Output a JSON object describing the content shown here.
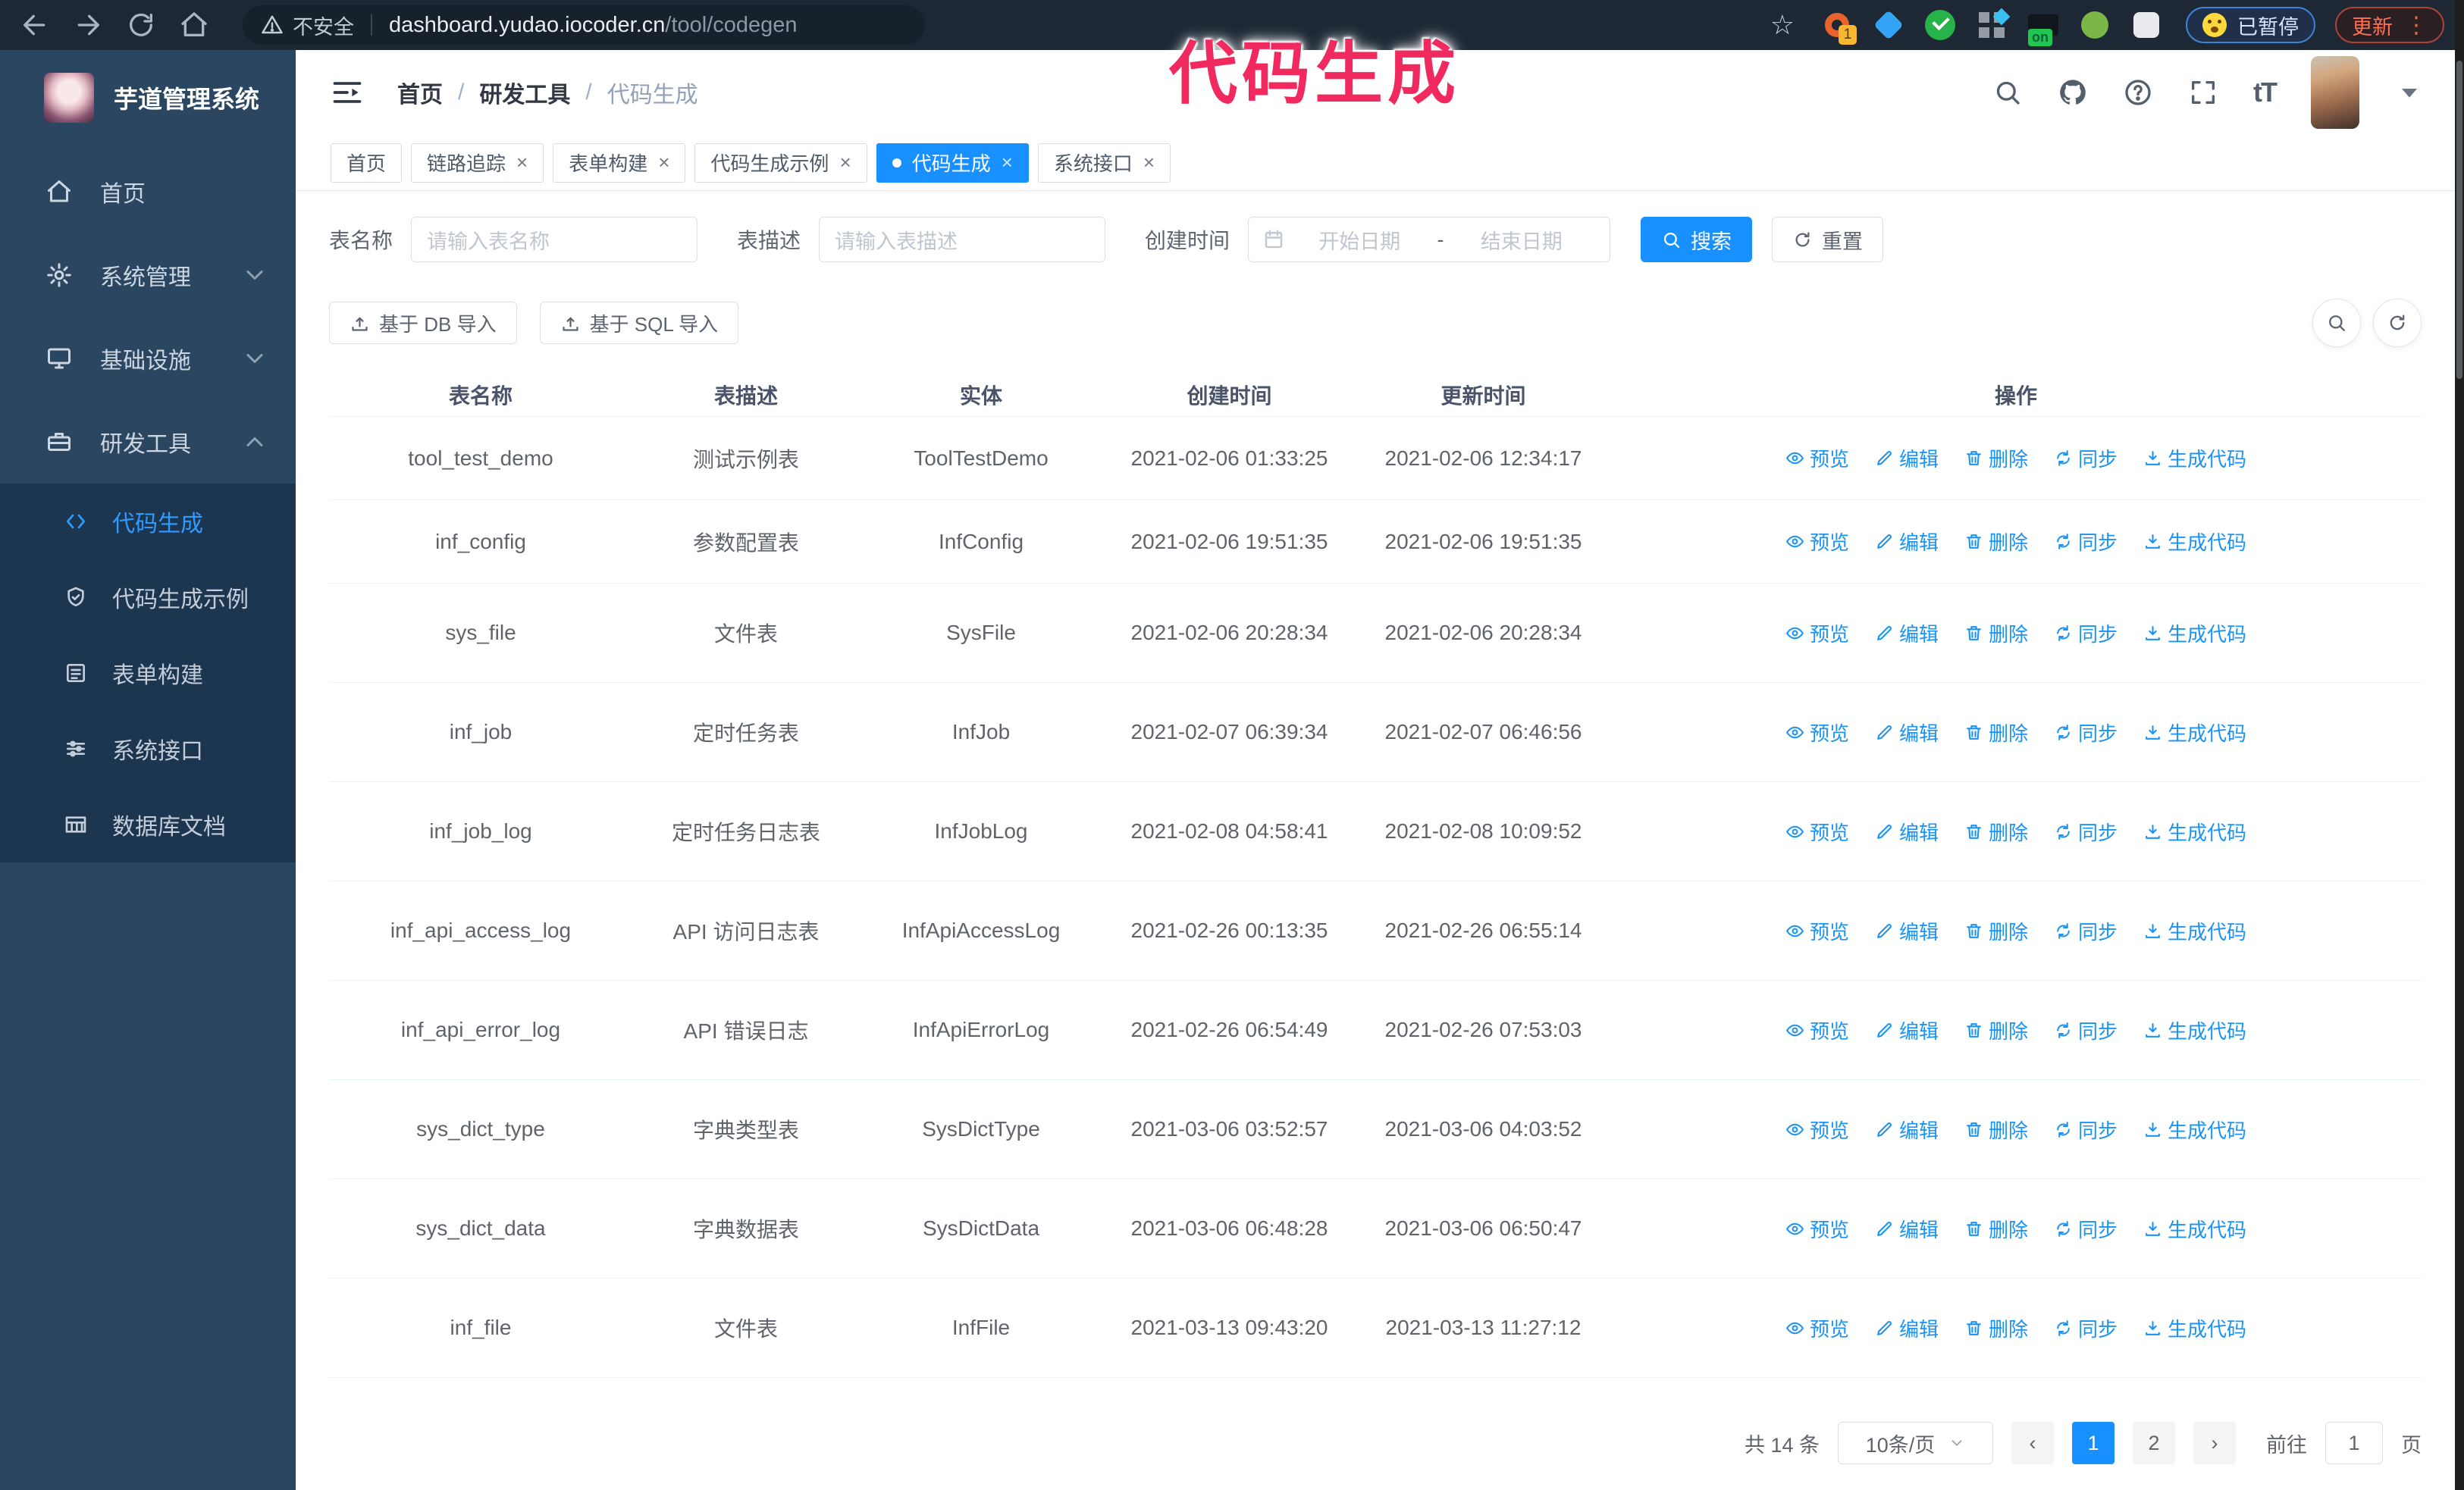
{
  "colors": {
    "accent": "#1890ff",
    "watermark": "#f0295e",
    "sidebar_bg": "#2a4661",
    "submenu_bg": "#1d3650"
  },
  "browser": {
    "security_label": "不安全",
    "url_host": "dashboard.yudao.iocoder.cn",
    "url_path": "/tool/codegen",
    "paused_badge": "已暂停",
    "update_label": "更新",
    "ext_badge_count": "1",
    "ext_badge_on": "on"
  },
  "watermark": {
    "text": "代码生成"
  },
  "sidebar": {
    "title": "芋道管理系统",
    "items": [
      {
        "label": "首页",
        "icon": "home-icon",
        "chevron": null,
        "active": false
      },
      {
        "label": "系统管理",
        "icon": "gear-icon",
        "chevron": "down",
        "active": false
      },
      {
        "label": "基础设施",
        "icon": "monitor-icon",
        "chevron": "down",
        "active": false
      },
      {
        "label": "研发工具",
        "icon": "toolbox-icon",
        "chevron": "up",
        "active": false
      }
    ],
    "submenu": [
      {
        "label": "代码生成",
        "icon": "code-icon",
        "active": true
      },
      {
        "label": "代码生成示例",
        "icon": "shield-check-icon",
        "active": false
      },
      {
        "label": "表单构建",
        "icon": "form-icon",
        "active": false
      },
      {
        "label": "系统接口",
        "icon": "sliders-icon",
        "active": false
      },
      {
        "label": "数据库文档",
        "icon": "db-table-icon",
        "active": false
      }
    ]
  },
  "header": {
    "breadcrumb": [
      {
        "label": "首页",
        "current": false
      },
      {
        "label": "研发工具",
        "current": false
      },
      {
        "label": "代码生成",
        "current": true
      }
    ],
    "font_size_icon_text": "tT"
  },
  "tabs": [
    {
      "label": "首页",
      "active": false,
      "closable": false
    },
    {
      "label": "链路追踪",
      "active": false,
      "closable": true
    },
    {
      "label": "表单构建",
      "active": false,
      "closable": true
    },
    {
      "label": "代码生成示例",
      "active": false,
      "closable": true
    },
    {
      "label": "代码生成",
      "active": true,
      "closable": true
    },
    {
      "label": "系统接口",
      "active": false,
      "closable": true
    }
  ],
  "filters": {
    "table_name_label": "表名称",
    "table_name_placeholder": "请输入表名称",
    "table_desc_label": "表描述",
    "table_desc_placeholder": "请输入表描述",
    "create_time_label": "创建时间",
    "date_start_placeholder": "开始日期",
    "date_end_placeholder": "结束日期",
    "search_label": "搜索",
    "reset_label": "重置"
  },
  "toolbar": {
    "import_db_label": "基于 DB 导入",
    "import_sql_label": "基于 SQL 导入"
  },
  "table": {
    "columns": [
      "表名称",
      "表描述",
      "实体",
      "创建时间",
      "更新时间",
      "操作"
    ],
    "action_labels": [
      "预览",
      "编辑",
      "删除",
      "同步",
      "生成代码"
    ],
    "rows": [
      {
        "name": "tool_test_demo",
        "desc": "测试示例表",
        "entity": "ToolTestDemo",
        "created": "2021-02-06 01:33:25",
        "updated": "2021-02-06 12:34:17",
        "created_wrap": false,
        "updated_wrap": false
      },
      {
        "name": "inf_config",
        "desc": "参数配置表",
        "entity": "InfConfig",
        "created": "2021-02-06 19:51:35",
        "updated": "2021-02-06 19:51:35",
        "created_wrap": false,
        "updated_wrap": false
      },
      {
        "name": "sys_file",
        "desc": "文件表",
        "entity": "SysFile",
        "created": "2021-02-06 20:28:34",
        "updated": "2021-02-06 20:28:34",
        "created_wrap": true,
        "updated_wrap": true
      },
      {
        "name": "inf_job",
        "desc": "定时任务表",
        "entity": "InfJob",
        "created": "2021-02-07 06:39:34",
        "updated": "2021-02-07 06:46:56",
        "created_wrap": true,
        "updated_wrap": true
      },
      {
        "name": "inf_job_log",
        "desc": "定时任务日志表",
        "entity": "InfJobLog",
        "created": "2021-02-08 04:58:41",
        "updated": "2021-02-08 10:09:52",
        "created_wrap": true,
        "updated_wrap": true
      },
      {
        "name": "inf_api_access_log",
        "desc": "API 访问日志表",
        "entity": "InfApiAccessLog",
        "created": "2021-02-26 00:13:35",
        "updated": "2021-02-26 06:55:14",
        "created_wrap": false,
        "updated_wrap": true
      },
      {
        "name": "inf_api_error_log",
        "desc": "API 错误日志",
        "entity": "InfApiErrorLog",
        "created": "2021-02-26 06:54:49",
        "updated": "2021-02-26 07:53:03",
        "created_wrap": true,
        "updated_wrap": true
      },
      {
        "name": "sys_dict_type",
        "desc": "字典类型表",
        "entity": "SysDictType",
        "created": "2021-03-06 03:52:57",
        "updated": "2021-03-06 04:03:52",
        "created_wrap": true,
        "updated_wrap": true
      },
      {
        "name": "sys_dict_data",
        "desc": "字典数据表",
        "entity": "SysDictData",
        "created": "2021-03-06 06:48:28",
        "updated": "2021-03-06 06:50:47",
        "created_wrap": true,
        "updated_wrap": true
      },
      {
        "name": "inf_file",
        "desc": "文件表",
        "entity": "InfFile",
        "created": "2021-03-13 09:43:20",
        "updated": "2021-03-13 11:27:12",
        "created_wrap": true,
        "updated_wrap": false
      }
    ]
  },
  "pagination": {
    "total_label": "共 14 条",
    "page_size_label": "10条/页",
    "pages": [
      "1",
      "2"
    ],
    "active_page": "1",
    "goto_label": "前往",
    "goto_value": "1",
    "goto_suffix": "页"
  },
  "glyphs": {
    "close": "×",
    "breadcrumb_separator": "/",
    "range_separator": "-",
    "prev": "‹",
    "next": "›",
    "star": "☆",
    "menu_dots": "⋮"
  }
}
